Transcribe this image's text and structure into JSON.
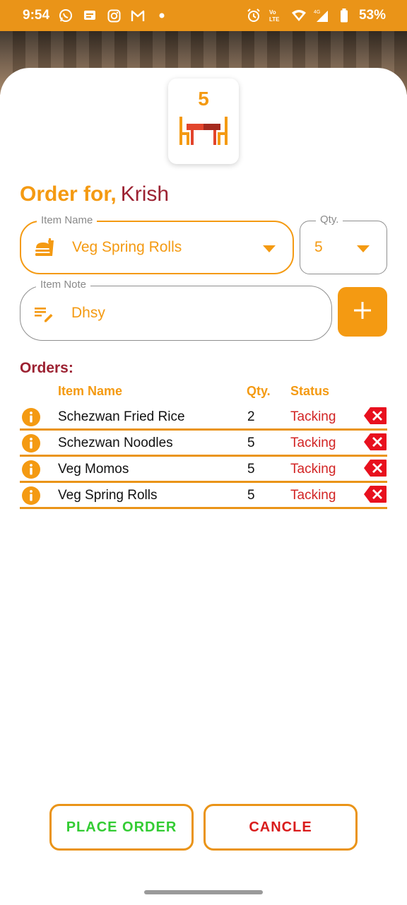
{
  "status_bar": {
    "time": "9:54",
    "battery": "53%",
    "left_icons": [
      "whatsapp-icon",
      "message-icon",
      "instagram-icon",
      "gmail-icon",
      "dot-icon"
    ],
    "right_icons": [
      "alarm-icon",
      "volte-icon",
      "wifi-icon",
      "signal-icon",
      "battery-icon"
    ]
  },
  "table": {
    "number": "5",
    "icon": "dining-table-icon"
  },
  "order": {
    "title_prefix": "Order for,",
    "customer": "Krish"
  },
  "form": {
    "item_name": {
      "label": "Item Name",
      "value": "Veg Spring Rolls",
      "icon": "food-icon"
    },
    "qty": {
      "label": "Qty.",
      "value": "5"
    },
    "item_note": {
      "label": "Item Note",
      "value": "Dhsy",
      "icon": "note-edit-icon"
    },
    "add_icon": "plus-icon"
  },
  "orders": {
    "heading": "Orders:",
    "columns": {
      "name": "Item Name",
      "qty": "Qty.",
      "status": "Status"
    },
    "rows": [
      {
        "name": "Schezwan Fried Rice",
        "qty": "2",
        "status": "Tacking"
      },
      {
        "name": "Schezwan Noodles",
        "qty": "5",
        "status": "Tacking"
      },
      {
        "name": "Veg Momos",
        "qty": "5",
        "status": "Tacking"
      },
      {
        "name": "Veg Spring Rolls",
        "qty": "5",
        "status": "Tacking"
      }
    ]
  },
  "actions": {
    "place_order": "PLACE ORDER",
    "cancel": "CANCLE"
  },
  "colors": {
    "accent": "#f49a12",
    "status_bar": "#ea9418",
    "heading": "#9c2232",
    "status": "#d22424",
    "delete": "#e8101e",
    "place": "#33cc33",
    "cancel": "#d91c1c"
  }
}
